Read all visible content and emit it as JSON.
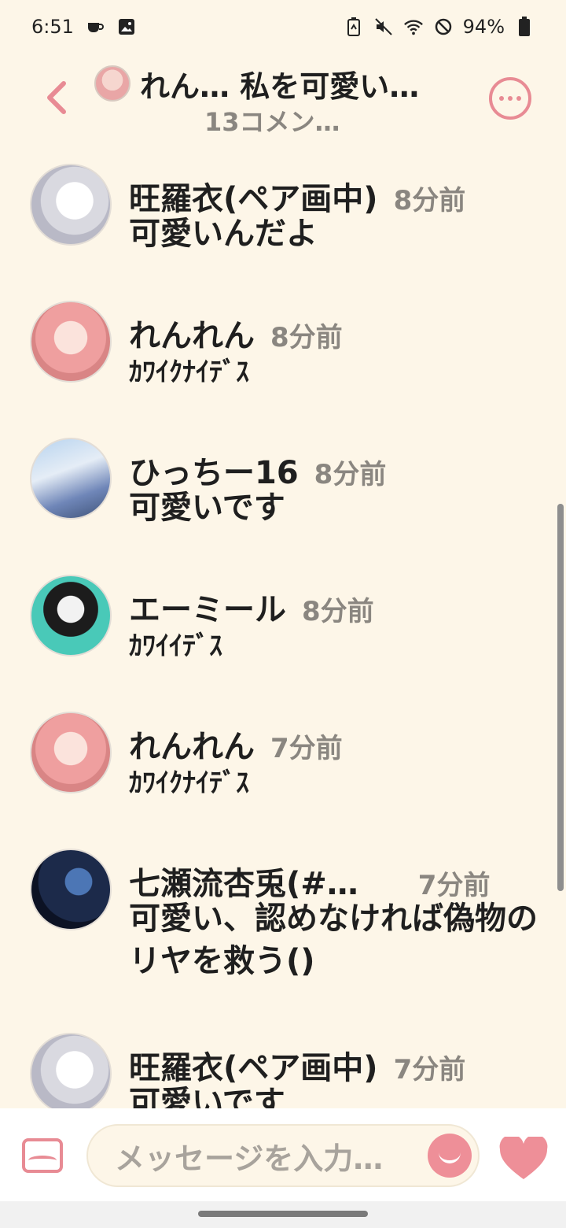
{
  "status_bar": {
    "time": "6:51",
    "battery": "94%",
    "icons_left": [
      "cup-icon",
      "image-icon"
    ],
    "icons_right": [
      "battery-saver-icon",
      "mute-icon",
      "wifi-icon",
      "do-not-disturb-icon",
      "battery-icon"
    ]
  },
  "header": {
    "title": "れん… 私を可愛い…",
    "subtitle": "13コメン…",
    "back_icon": "chevron-left-icon",
    "more_icon": "more-icon"
  },
  "comments": [
    {
      "name": "旺羅衣(ペア画中)",
      "time": "8分前",
      "text": "可愛いんだよ"
    },
    {
      "name": "れんれん",
      "time": "8分前",
      "text": "ｶﾜｲｸﾅｲﾃﾞｽ"
    },
    {
      "name": "ひっちー16",
      "time": "8分前",
      "text": "可愛いです"
    },
    {
      "name": "エーミール",
      "time": "8分前",
      "text": "ｶﾜｲｲﾃﾞｽ"
    },
    {
      "name": "れんれん",
      "time": "7分前",
      "text": "ｶﾜｲｸﾅｲﾃﾞｽ"
    },
    {
      "name": "七瀬流杏兎(#…",
      "time": "7分前",
      "text": "可愛い、認めなければ偽物のリヤを救う()"
    },
    {
      "name": "旺羅衣(ペア画中)",
      "time": "7分前",
      "text": "可愛いです"
    }
  ],
  "composer": {
    "placeholder": "メッセージを入力…",
    "image_icon": "image-icon",
    "emoji_icon": "smile-icon",
    "like_icon": "heart-icon"
  },
  "colors": {
    "background": "#fdf6e8",
    "accent": "#e88b94",
    "muted_text": "#8a8680"
  }
}
